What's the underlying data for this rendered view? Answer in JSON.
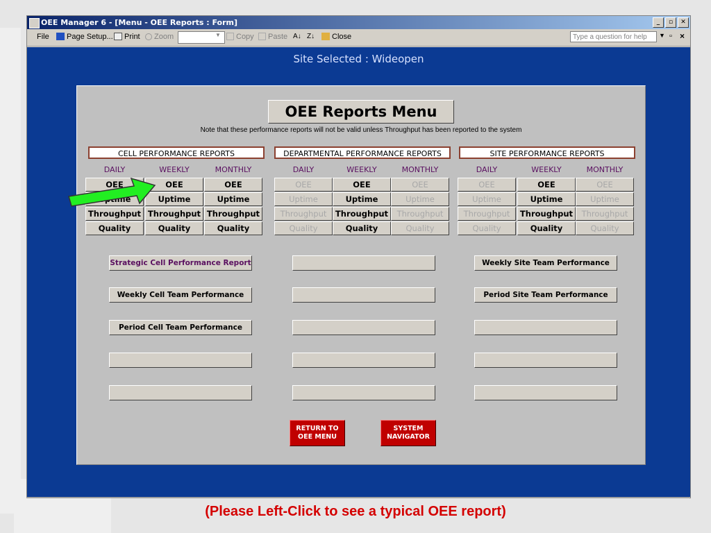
{
  "window": {
    "title": "OEE Manager 6 - [Menu - OEE Reports : Form]"
  },
  "toolbar": {
    "file": "File",
    "page_setup": "Page Setup...",
    "print": "Print",
    "zoom": "Zoom",
    "copy": "Copy",
    "paste": "Paste",
    "close": "Close",
    "help_placeholder": "Type a question for help"
  },
  "site_selected": "Site Selected :  Wideopen",
  "menu_title": "OEE Reports Menu",
  "note": "Note that these performance reports will not be valid unless Throughput has been reported to the system",
  "sections": {
    "cell": "CELL PERFORMANCE REPORTS",
    "departmental": "DEPARTMENTAL PERFORMANCE REPORTS",
    "site": "SITE PERFORMANCE REPORTS"
  },
  "columns": {
    "daily": "DAILY",
    "weekly": "WEEKLY",
    "monthly": "MONTHLY"
  },
  "metrics": {
    "oee": "OEE",
    "uptime": "Uptime",
    "throughput": "Throughput",
    "quality": "Quality"
  },
  "reports": {
    "strategic_cell": "Strategic Cell Performance Report",
    "weekly_cell_team": "Weekly Cell Team Performance",
    "period_cell_team": "Period Cell Team Performance",
    "weekly_site_team": "Weekly Site Team Performance",
    "period_site_team": "Period Site Team  Performance"
  },
  "buttons": {
    "return_1": "RETURN TO",
    "return_2": "OEE MENU",
    "sysnav_1": "SYSTEM",
    "sysnav_2": "NAVIGATOR"
  },
  "caption": "(Please Left-Click to see a typical OEE report)",
  "colors": {
    "accent_blue": "#0b3a93",
    "header_border": "#8b4030",
    "red_button": "#c00000",
    "arrow_green": "#22ee22",
    "caption_red": "#d40000"
  }
}
